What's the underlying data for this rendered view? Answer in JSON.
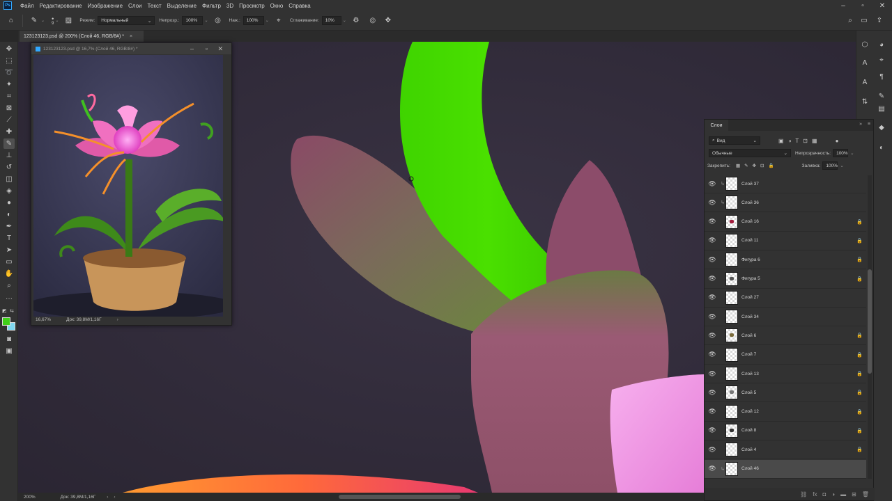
{
  "menubar": {
    "items": [
      "Файл",
      "Редактирование",
      "Изображение",
      "Слои",
      "Текст",
      "Выделение",
      "Фильтр",
      "3D",
      "Просмотр",
      "Окно",
      "Справка"
    ]
  },
  "options": {
    "brush_size": "9",
    "mode_label": "Режим:",
    "mode_value": "Нормальный",
    "opacity_label": "Непрозр.:",
    "opacity_value": "100%",
    "pressure_label": "Наж.:",
    "pressure_value": "100%",
    "smoothing_label": "Сглаживание:",
    "smoothing_value": "10%"
  },
  "document": {
    "tab_title": "123123123.psd @ 200% (Слой 46, RGB/8#) *",
    "zoom": "200%",
    "doc_info": "Док: 39,8M/1,16Г"
  },
  "float_window": {
    "title": "123123123.psd @ 16,7% (Слой 46, RGB/8#) *",
    "zoom": "16,67%",
    "doc_info": "Док: 39,8M/1,16Г"
  },
  "layers_panel": {
    "tab_label": "Слои",
    "filter_label": "Вид",
    "blend_mode": "Обычные",
    "opacity_label": "Непрозрачность:",
    "opacity_value": "100%",
    "lock_label": "Закрепить:",
    "fill_label": "Заливка:",
    "fill_value": "100%",
    "layers": [
      {
        "name": "Слой 37",
        "clipped": true,
        "locked": false,
        "selected": false,
        "thumb_mark": ""
      },
      {
        "name": "Слой 36",
        "clipped": true,
        "locked": false,
        "selected": false,
        "thumb_mark": ""
      },
      {
        "name": "Слой 16",
        "clipped": false,
        "locked": true,
        "selected": false,
        "thumb_mark": "#a31d3d"
      },
      {
        "name": "Слой 11",
        "clipped": false,
        "locked": true,
        "selected": false,
        "thumb_mark": ""
      },
      {
        "name": "Фигура 6",
        "clipped": false,
        "locked": true,
        "selected": false,
        "thumb_mark": ""
      },
      {
        "name": "Фигура 5",
        "clipped": false,
        "locked": true,
        "selected": false,
        "thumb_mark": "#555555"
      },
      {
        "name": "Слой 27",
        "clipped": false,
        "locked": false,
        "selected": false,
        "thumb_mark": ""
      },
      {
        "name": "Слой 34",
        "clipped": false,
        "locked": false,
        "selected": false,
        "thumb_mark": ""
      },
      {
        "name": "Слой 6",
        "clipped": false,
        "locked": true,
        "selected": false,
        "thumb_mark": "#7a6a3a"
      },
      {
        "name": "Слой 7",
        "clipped": false,
        "locked": true,
        "selected": false,
        "thumb_mark": ""
      },
      {
        "name": "Слой 13",
        "clipped": false,
        "locked": true,
        "selected": false,
        "thumb_mark": ""
      },
      {
        "name": "Слой 5",
        "clipped": false,
        "locked": true,
        "selected": false,
        "thumb_mark": "#777777"
      },
      {
        "name": "Слой 12",
        "clipped": false,
        "locked": true,
        "selected": false,
        "thumb_mark": ""
      },
      {
        "name": "Слой 8",
        "clipped": false,
        "locked": true,
        "selected": false,
        "thumb_mark": "#333333"
      },
      {
        "name": "Слой 4",
        "clipped": false,
        "locked": true,
        "selected": false,
        "thumb_mark": ""
      },
      {
        "name": "Слой 46",
        "clipped": true,
        "locked": false,
        "selected": true,
        "thumb_mark": ""
      }
    ]
  },
  "colors": {
    "foreground": "#3fcf1a",
    "background": "#7fd7f0",
    "canvas_bg": "#2f2a38",
    "leaf_green": "#44dd00",
    "petal_mauve": "#9a5a74",
    "petal_pink": "#f08ce0"
  }
}
